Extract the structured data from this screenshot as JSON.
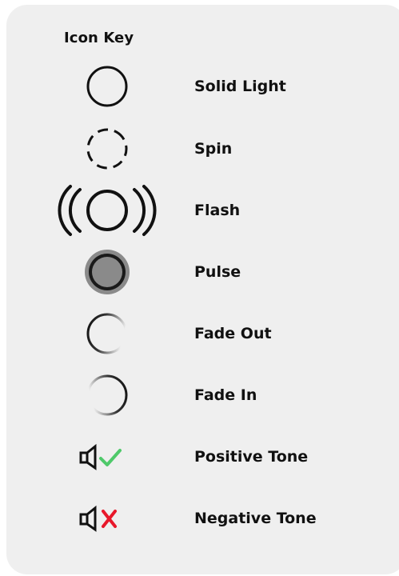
{
  "title": "Icon Key",
  "items": [
    {
      "icon": "solid-circle-icon",
      "label": "Solid Light"
    },
    {
      "icon": "dashed-circle-icon",
      "label": "Spin"
    },
    {
      "icon": "flash-circle-icon",
      "label": "Flash"
    },
    {
      "icon": "pulse-circle-icon",
      "label": "Pulse"
    },
    {
      "icon": "fade-out-circle-icon",
      "label": "Fade Out"
    },
    {
      "icon": "fade-in-circle-icon",
      "label": "Fade In"
    },
    {
      "icon": "speaker-check-icon",
      "label": "Positive Tone"
    },
    {
      "icon": "speaker-x-icon",
      "label": "Negative Tone"
    }
  ],
  "colors": {
    "background": "#efefef",
    "text": "#111111",
    "positive": "#4fc96a",
    "negative": "#e8182b",
    "pulse_ring": "#8a8a8a"
  }
}
